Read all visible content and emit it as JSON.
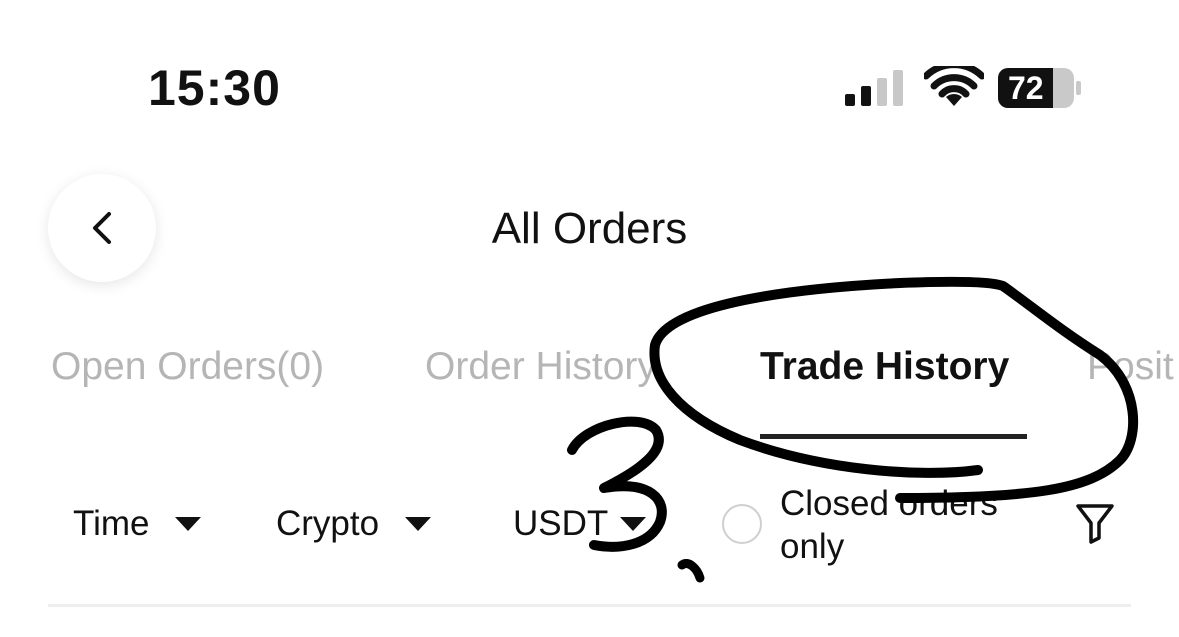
{
  "status_bar": {
    "time": "15:30",
    "battery": "72",
    "icons": [
      "cellular-signal-icon",
      "wifi-icon",
      "battery-icon"
    ]
  },
  "header": {
    "title": "All Orders",
    "back_icon": "chevron-left-icon"
  },
  "tabs": [
    {
      "label": "Open Orders(0)",
      "active": false
    },
    {
      "label": "Order History",
      "active": false
    },
    {
      "label": "Trade History",
      "active": true
    },
    {
      "label": "Posit",
      "active": false
    }
  ],
  "filters": {
    "time": "Time",
    "crypto": "Crypto",
    "currency": "USDT",
    "closed_orders_label": "Closed orders only",
    "filter_icon": "funnel-icon"
  },
  "annotation": {
    "mark": "3",
    "color": "#000000"
  },
  "colors": {
    "text": "#111111",
    "inactive_tab": "#b5b5b5",
    "underline": "#222222"
  }
}
